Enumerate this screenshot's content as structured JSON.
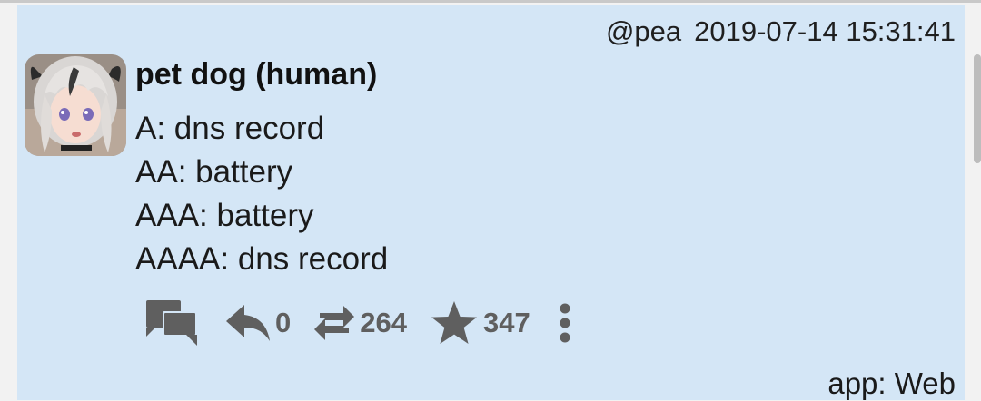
{
  "post": {
    "handle": "@pea",
    "timestamp": "2019-07-14 15:31:41",
    "display_name": "pet dog (human)",
    "body_lines": [
      "A: dns record",
      "AA: battery",
      "AAA: battery",
      "AAAA: dns record"
    ],
    "app": "app: Web",
    "counts": {
      "reply": "0",
      "repeat": "264",
      "favorite": "347"
    },
    "icons": {
      "conversation": "conversation-icon",
      "reply": "reply-icon",
      "repeat": "repeat-icon",
      "favorite": "star-icon",
      "more": "more-vertical-icon"
    }
  },
  "colors": {
    "card_background": "#d4e6f6",
    "icon_gray": "#5f5f5f"
  }
}
